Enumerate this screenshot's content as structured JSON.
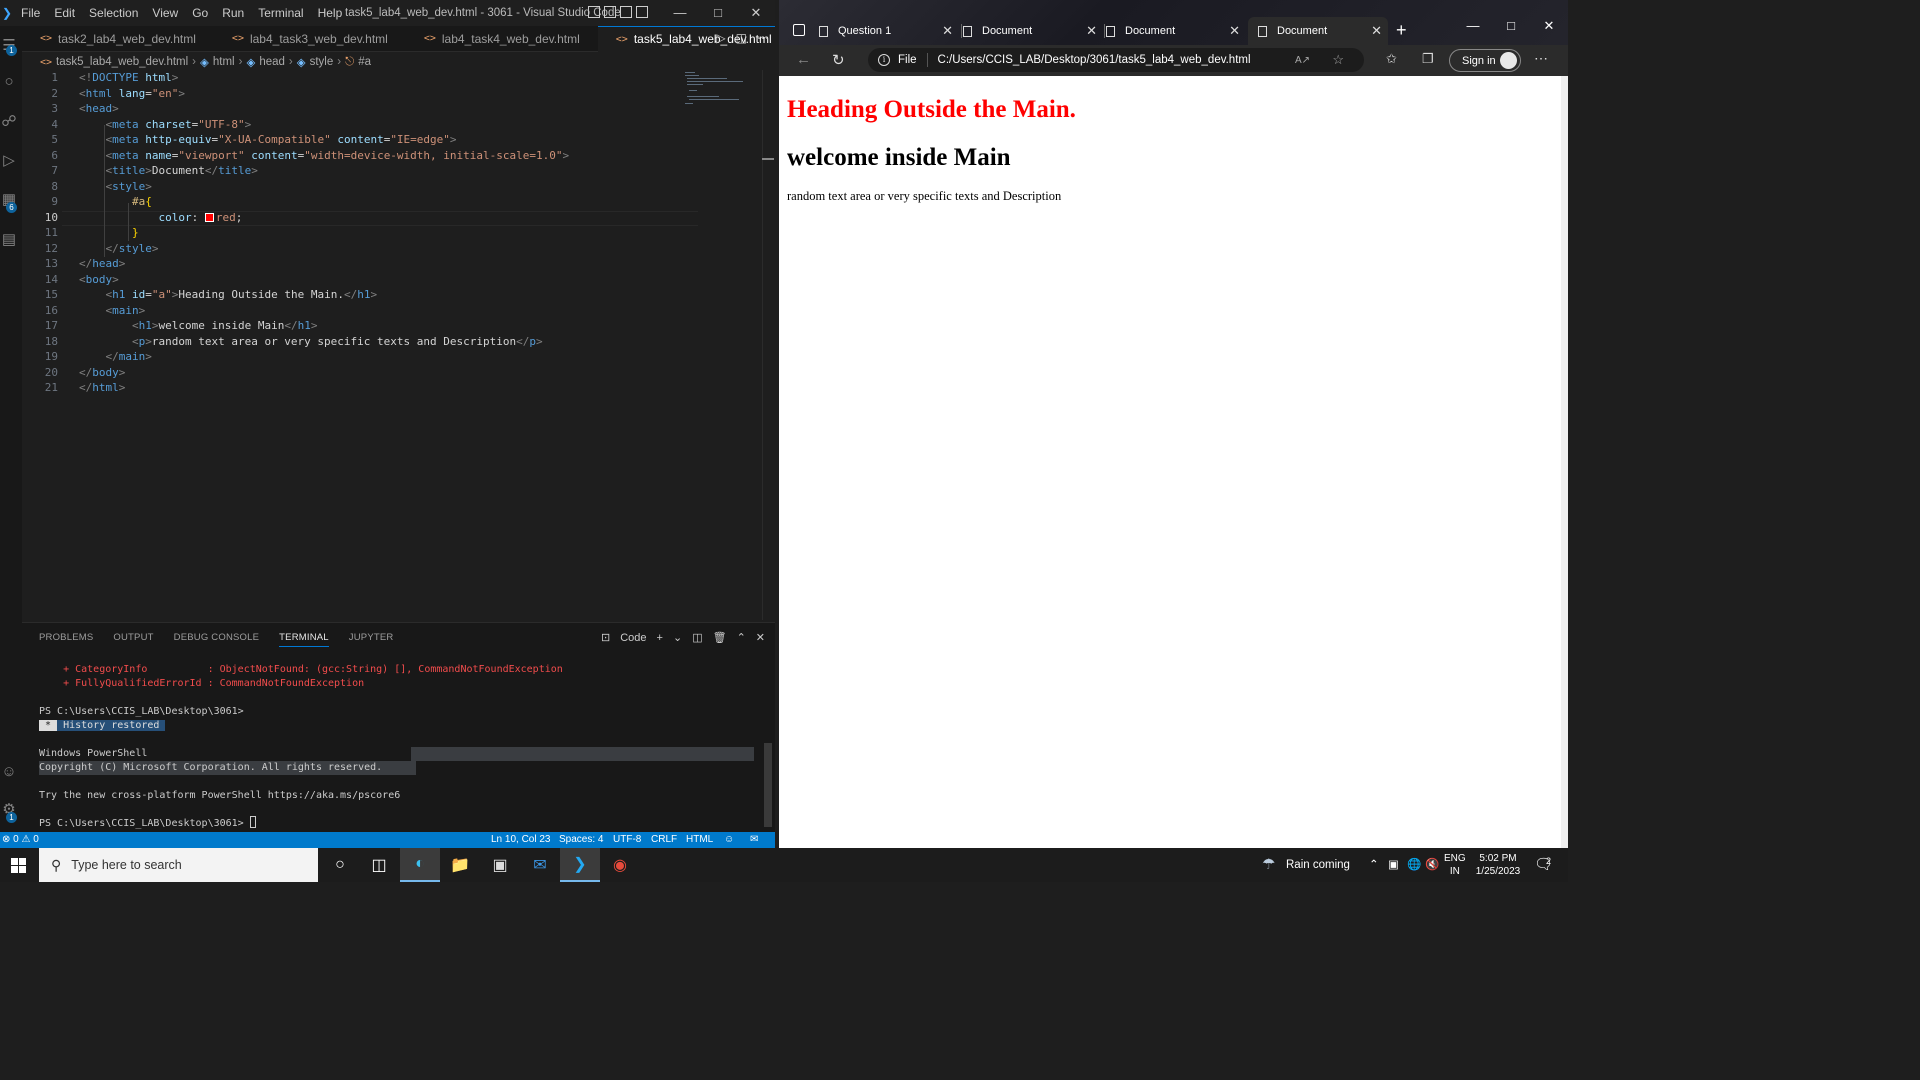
{
  "vscode": {
    "menu": [
      "File",
      "Edit",
      "Selection",
      "View",
      "Go",
      "Run",
      "Terminal",
      "Help"
    ],
    "window_title": "task5_lab4_web_dev.html - 3061 - Visual Studio Code",
    "tabs": [
      {
        "label": "task2_lab4_web_dev.html",
        "active": false
      },
      {
        "label": "lab4_task3_web_dev.html",
        "active": false
      },
      {
        "label": "lab4_task4_web_dev.html",
        "active": false
      },
      {
        "label": "task5_lab4_web_dev.html",
        "active": true
      }
    ],
    "activity_badges": {
      "explorer": "1",
      "extensions": "6",
      "settings": "1"
    },
    "breadcrumb": {
      "file": "task5_lab4_web_dev.html",
      "items": [
        "html",
        "head",
        "style",
        "#a"
      ]
    },
    "line_numbers": [
      "1",
      "2",
      "3",
      "4",
      "5",
      "6",
      "7",
      "8",
      "9",
      "10",
      "11",
      "12",
      "13",
      "14",
      "15",
      "16",
      "17",
      "18",
      "19",
      "20",
      "21"
    ],
    "code": {
      "l1": {
        "open": "<!",
        "kw": "DOCTYPE",
        "sp": " ",
        "name": "html",
        "close": ">"
      },
      "l2": {
        "tag": "html",
        "attr": "lang",
        "val": "\"en\""
      },
      "l3": {
        "tag": "head"
      },
      "l4": {
        "tag": "meta",
        "attr": "charset",
        "val": "\"UTF-8\""
      },
      "l5": {
        "tag": "meta",
        "attr1": "http-equiv",
        "val1": "\"X-UA-Compatible\"",
        "attr2": "content",
        "val2": "\"IE=edge\""
      },
      "l6": {
        "tag": "meta",
        "attr1": "name",
        "val1": "\"viewport\"",
        "attr2": "content",
        "val2": "\"width=device-width, initial-scale=1.0\""
      },
      "l7": {
        "tag": "title",
        "text": "Document"
      },
      "l8": {
        "tag": "style"
      },
      "l9": {
        "selector": "#a",
        "brace": "{"
      },
      "l10": {
        "prop": "color",
        "colon": ": ",
        "value": "red",
        "semi": ";"
      },
      "l11": {
        "brace": "}"
      },
      "l12": {
        "tag": "style"
      },
      "l13": {
        "tag": "head"
      },
      "l14": {
        "tag": "body"
      },
      "l15": {
        "tag": "h1",
        "attr": "id",
        "val": "\"a\"",
        "text": "Heading Outside the Main."
      },
      "l16": {
        "tag": "main"
      },
      "l17": {
        "tag": "h1",
        "text": "welcome inside Main"
      },
      "l18": {
        "tag": "p",
        "text": "random text area or very specific texts and Description"
      },
      "l19": {
        "tag": "main"
      },
      "l20": {
        "tag": "body"
      },
      "l21": {
        "tag": "html"
      }
    },
    "panel": {
      "tabs": [
        "PROBLEMS",
        "OUTPUT",
        "DEBUG CONSOLE",
        "TERMINAL",
        "JUPYTER"
      ],
      "active_tab": "TERMINAL",
      "terminal_name": "Code",
      "lines": {
        "err1_key": "    + CategoryInfo          ",
        "err1_val": ": ObjectNotFound: (gcc:String) [], CommandNotFoundException",
        "err2_key": "    + FullyQualifiedErrorId ",
        "err2_val": ": CommandNotFoundException",
        "prompt1": "PS C:\\Users\\CCIS_LAB\\Desktop\\3061>",
        "hist_star": " * ",
        "hist_text": " History restored ",
        "ps_title": "Windows PowerShell",
        "copyright": "Copyright (C) Microsoft Corporation. All rights reserved.",
        "try": "Try the new cross-platform PowerShell https://aka.ms/pscore6",
        "prompt2": "PS C:\\Users\\CCIS_LAB\\Desktop\\3061> "
      }
    },
    "status": {
      "problems": "⊗ 0 ⚠ 0",
      "position": "Ln 10, Col 23",
      "spaces": "Spaces: 4",
      "encoding": "UTF-8",
      "eol": "CRLF",
      "language": "HTML"
    }
  },
  "edge": {
    "tabs": [
      {
        "label": "Question 1",
        "active": false
      },
      {
        "label": "Document",
        "active": false
      },
      {
        "label": "Document",
        "active": false
      },
      {
        "label": "Document",
        "active": true
      }
    ],
    "address": {
      "scheme_label": "File",
      "url": "C:/Users/CCIS_LAB/Desktop/3061/task5_lab4_web_dev.html"
    },
    "signin_label": "Sign in",
    "page": {
      "h1_red": "Heading Outside the Main.",
      "h1_main": "welcome inside Main",
      "paragraph": "random text area or very specific texts and Description"
    }
  },
  "taskbar": {
    "search_placeholder": "Type here to search",
    "weather": "Rain coming",
    "lang_top": "ENG",
    "lang_bottom": "IN",
    "time": "5:02 PM",
    "date": "1/25/2023",
    "notification_count": "2"
  },
  "colors": {
    "vscode_accent": "#007acc",
    "heading_red": "#ff0000"
  }
}
